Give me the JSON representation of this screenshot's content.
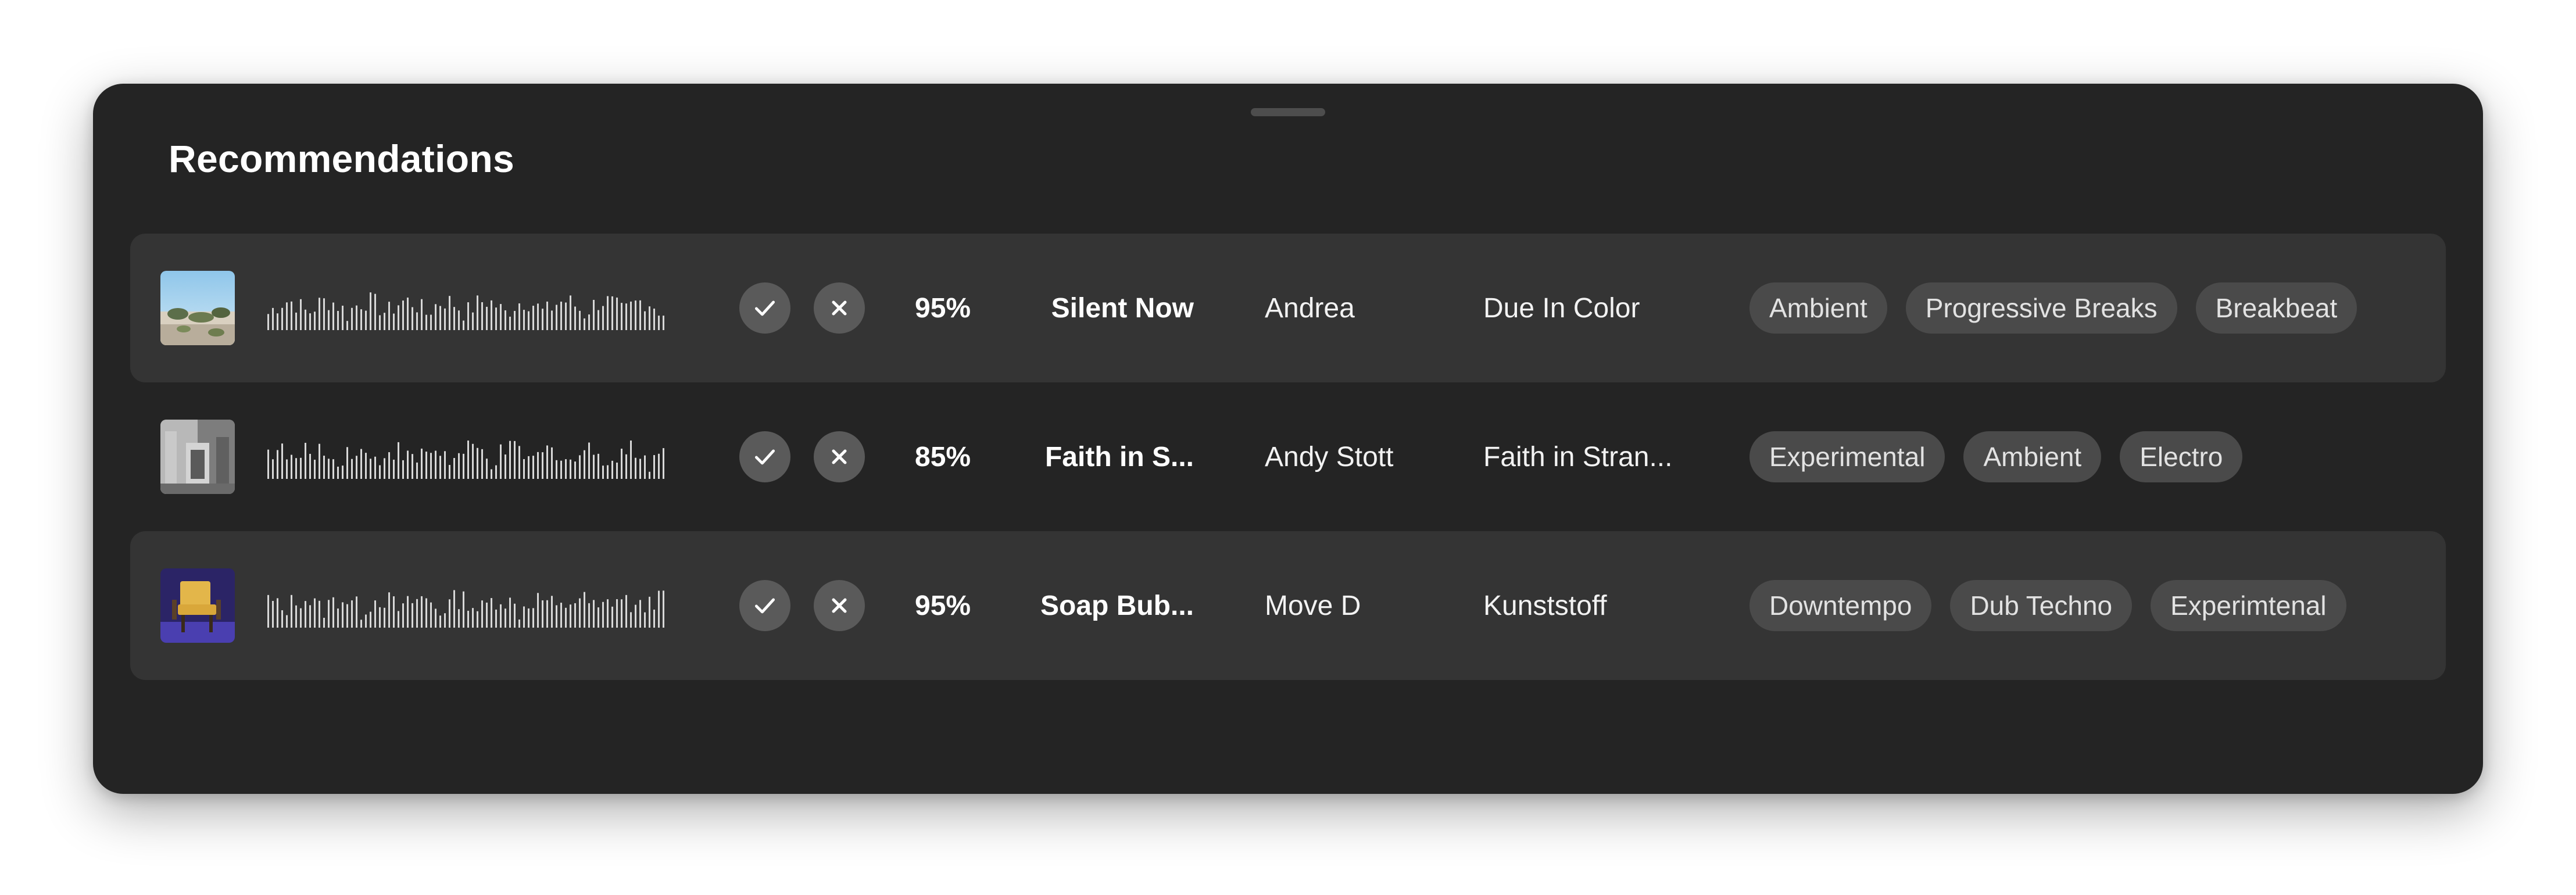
{
  "panel": {
    "title": "Recommendations"
  },
  "rows": [
    {
      "match": "95%",
      "track": "Silent Now",
      "artist": "Andrea",
      "album": "Due In Color",
      "tags": [
        "Ambient",
        "Progressive Breaks",
        "Breakbeat"
      ],
      "cover_icon": "desert-landscape-cover",
      "shaded": true
    },
    {
      "match": "85%",
      "track": "Faith in S...",
      "artist": "Andy Stott",
      "album": "Faith in Stran...",
      "tags": [
        "Experimental",
        "Ambient",
        "Electro"
      ],
      "cover_icon": "grayscale-building-cover",
      "shaded": false
    },
    {
      "match": "95%",
      "track": "Soap Bub...",
      "artist": "Move D",
      "album": "Kunststoff",
      "tags": [
        "Downtempo",
        "Dub Techno",
        "Experimtenal"
      ],
      "cover_icon": "yellow-chair-cover",
      "shaded": true
    }
  ],
  "icons": {
    "accept": "check-icon",
    "reject": "close-icon"
  },
  "colors": {
    "panel_bg": "#242424",
    "row_shaded_bg": "#343434",
    "button_bg": "#5a5a5a",
    "tag_bg": "#4a4a4a",
    "text": "#ffffff"
  }
}
